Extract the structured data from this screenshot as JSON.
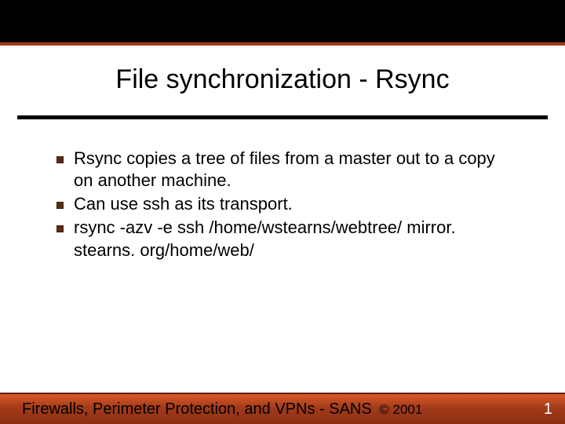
{
  "slide": {
    "title": "File synchronization - Rsync",
    "bullets": [
      "Rsync copies a tree of files from a master out to a copy on another machine.",
      "Can use ssh as its transport.",
      "rsync -azv -e ssh /home/wstearns/webtree/ mirror. stearns. org/home/web/"
    ]
  },
  "footer": {
    "text": "Firewalls, Perimeter Protection, and VPNs - SANS ",
    "copyright": "© 2001",
    "page": "1"
  }
}
